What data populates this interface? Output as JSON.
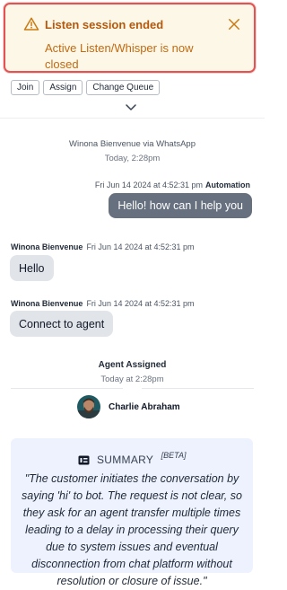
{
  "toast": {
    "title": "Listen session ended",
    "message": "Active Listen/Whisper is now closed",
    "border_color": "#e25353"
  },
  "actions": {
    "join": "Join",
    "assign": "Assign",
    "change_queue": "Change Queue"
  },
  "conversation": {
    "source": "Winona Bienvenue via WhatsApp",
    "source_time": "Today, 2:28pm",
    "messages": [
      {
        "direction": "out",
        "sender": "Automation",
        "timestamp": "Fri Jun 14 2024 at 4:52:31 pm",
        "text": "Hello! how can I help you"
      },
      {
        "direction": "in",
        "sender": "Winona Bienvenue",
        "timestamp": "Fri Jun 14 2024 at 4:52:31 pm",
        "text": "Hello"
      },
      {
        "direction": "in",
        "sender": "Winona Bienvenue",
        "timestamp": "Fri Jun 14 2024 at 4:52:31 pm",
        "text": "Connect to agent"
      }
    ],
    "agent_event": {
      "title": "Agent Assigned",
      "time": "Today at 2:28pm",
      "agent_name": "Charlie Abraham"
    }
  },
  "summary": {
    "label": "SUMMARY",
    "badge": "[BETA]",
    "text": "\"The customer initiates the conversation by saying 'hi' to bot. The request is not clear, so they ask for an agent transfer multiple times leading to a delay in processing their query due to system issues and eventual disconnection from chat platform without resolution or closure of issue.\""
  }
}
